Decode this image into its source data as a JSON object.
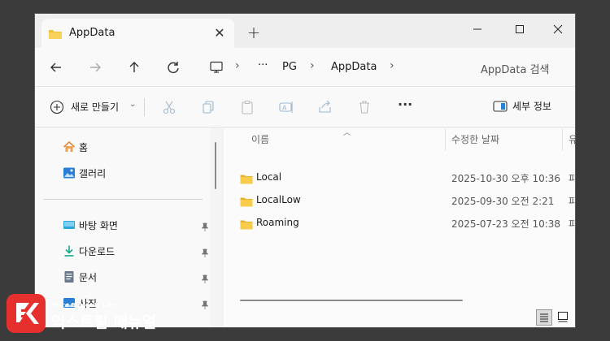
{
  "titlebar": {
    "tab_title": "AppData",
    "tab_close": "✕",
    "new_tab": "+"
  },
  "navbar": {
    "breadcrumb": [
      "PG",
      "AppData"
    ],
    "more": "···",
    "search_placeholder": "AppData 검색"
  },
  "toolbar": {
    "new_label": "새로 만들기",
    "more": "···",
    "details_label": "세부 정보"
  },
  "sidebar": {
    "items": [
      {
        "label": "홈",
        "icon": "home-icon"
      },
      {
        "label": "갤러리",
        "icon": "gallery-icon"
      },
      {
        "label": "바탕 화면",
        "icon": "desktop-icon",
        "pinned": true
      },
      {
        "label": "다운로드",
        "icon": "download-icon",
        "pinned": true
      },
      {
        "label": "문서",
        "icon": "document-icon",
        "pinned": true
      },
      {
        "label": "사진",
        "icon": "pictures-icon",
        "pinned": true
      }
    ]
  },
  "content": {
    "columns": [
      "이름",
      "수정한 날짜",
      "유"
    ],
    "rows": [
      {
        "name": "Local",
        "date": "2025-10-30 오후 10:36",
        "type": "파"
      },
      {
        "name": "LocalLow",
        "date": "2025-09-30 오전 2:21",
        "type": "파"
      },
      {
        "name": "Roaming",
        "date": "2025-07-23 오전 10:38",
        "type": "파"
      }
    ]
  },
  "watermark": {
    "tagline": "More Better IT Life",
    "name": "익스트림 매뉴얼",
    "brand_color": "#e5302e"
  },
  "colors": {
    "folder": "#f3c23c",
    "accent": "#2a7fd4"
  }
}
